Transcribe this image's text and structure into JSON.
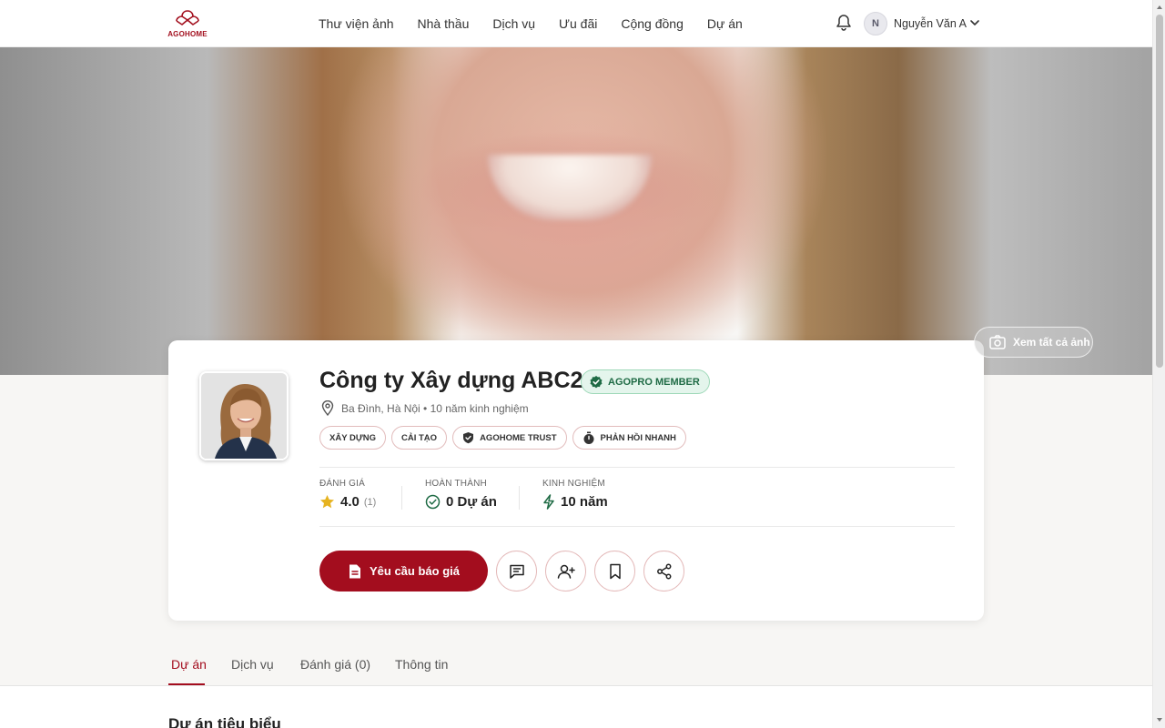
{
  "header": {
    "logo_text": "AGOHOME",
    "nav": [
      "Thư viện ảnh",
      "Nhà thầu",
      "Dịch vụ",
      "Ưu đãi",
      "Cộng đồng",
      "Dự án"
    ],
    "user_initial": "N",
    "user_name": "Nguyễn Văn A"
  },
  "hero": {
    "view_all_label": "Xem tất cả ảnh"
  },
  "profile": {
    "company_name": "Công ty Xây dựng ABC2",
    "member_badge": "AGOPRO MEMBER",
    "location": "Ba Đình, Hà Nội • 10 năm kinh nghiệm",
    "tags": [
      "XÂY DỰNG",
      "CẢI TẠO",
      "AGOHOME TRUST",
      "PHẢN HỒI NHANH"
    ],
    "stats": {
      "rating_label": "ĐÁNH GIÁ",
      "rating_value": "4.0",
      "rating_count": "(1)",
      "completed_label": "HOÀN THÀNH",
      "completed_value": "0 Dự án",
      "experience_label": "KINH NGHIỆM",
      "experience_value": "10 năm"
    },
    "quote_button": "Yêu cầu báo giá"
  },
  "tabs": [
    "Dự án",
    "Dịch vụ",
    "Đánh giá (0)",
    "Thông tin"
  ],
  "section_title": "Dự án tiêu biểu",
  "colors": {
    "brand": "#a30d1e",
    "member_green": "#1f6b45"
  }
}
